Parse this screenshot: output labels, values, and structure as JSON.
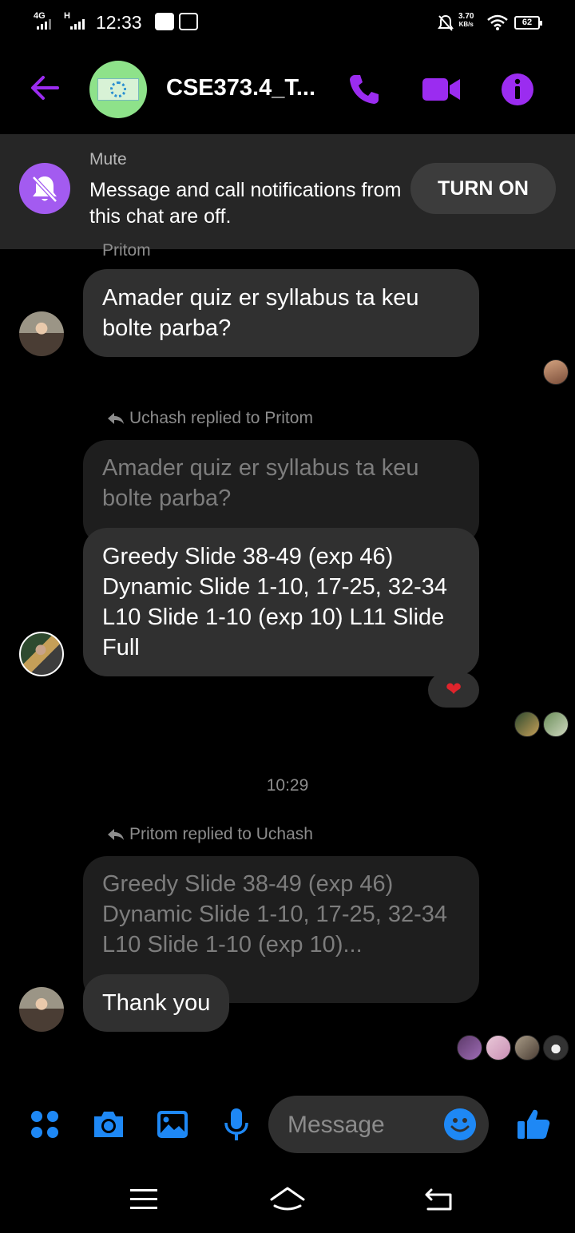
{
  "status_bar": {
    "network_1": "4G",
    "network_2": "H",
    "time": "12:33",
    "speed": "3.70",
    "speed_unit": "KB/s",
    "battery": "62"
  },
  "header": {
    "title": "CSE373.4_T..."
  },
  "mute_banner": {
    "label": "Mute",
    "text": "Message and call notifications from this chat are off.",
    "button": "TURN ON"
  },
  "messages": {
    "sender_name": "Pritom",
    "m1_text": "Amader quiz er syllabus ta keu bolte parba?",
    "reply1_header": "Uchash replied to Pritom",
    "reply1_quote": "Amader quiz er syllabus ta keu bolte parba?",
    "reply1_text": "Greedy Slide 38-49 (exp 46) Dynamic Slide 1-10, 17-25, 32-34 L10 Slide 1-10 (exp 10) L11 Slide Full",
    "reply1_reaction": "❤",
    "timestamp": "10:29",
    "reply2_header": "Pritom replied to Uchash",
    "reply2_quote": "Greedy Slide 38-49 (exp 46) Dynamic Slide 1-10, 17-25, 32-34 L10 Slide 1-10 (exp 10)...",
    "reply2_text": "Thank you"
  },
  "composer": {
    "placeholder": "Message"
  },
  "colors": {
    "accent_purple": "#9b2cf0",
    "accent_blue": "#1e88f5",
    "bubble": "#303030",
    "quote_bubble": "#1e1e1e",
    "banner": "#262626"
  },
  "icons": {
    "back": "arrow-left-icon",
    "call": "phone-icon",
    "video": "video-camera-icon",
    "info": "info-icon",
    "mute": "bell-slash-icon",
    "reply": "reply-arrow-icon",
    "menu": "grid-dots-icon",
    "camera": "camera-icon",
    "gallery": "image-icon",
    "mic": "microphone-icon",
    "emoji": "smiley-icon",
    "like": "thumbs-up-icon"
  }
}
